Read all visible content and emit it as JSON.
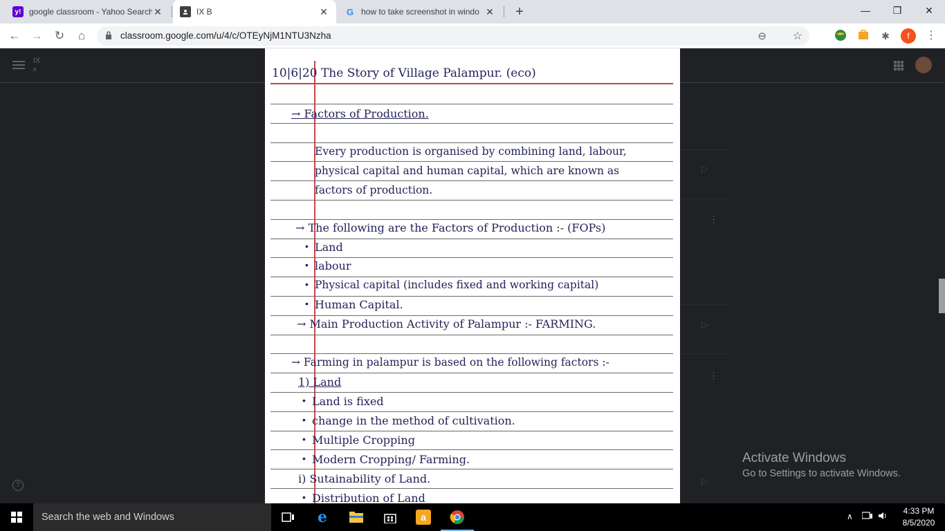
{
  "browser": {
    "tabs": [
      {
        "favicon": "y!",
        "title": "google classroom - Yahoo Search",
        "close": "✕"
      },
      {
        "favicon": "",
        "title": "IX B",
        "close": "✕"
      },
      {
        "favicon": "G",
        "title": "how to take screenshot in windo",
        "close": "✕"
      }
    ],
    "new_tab": "+",
    "window_controls": {
      "minimize": "—",
      "restore": "❐",
      "close": "✕"
    },
    "url": "classroom.google.com/u/4/c/OTEyNjM1NTU3Nzha",
    "nav": {
      "back": "←",
      "forward": "→",
      "reload": "↻",
      "home": "⌂"
    },
    "extensions": {
      "zoom": "⊖",
      "star": "☆",
      "puzzle": "✱",
      "profile": "f",
      "menu": "⋮"
    }
  },
  "classroom": {
    "class_name": "IX",
    "class_section": "B",
    "help": "?"
  },
  "notebook": {
    "lines": [
      {
        "text": "10|6|20  The Story of Village Palampur. (eco)",
        "underline": false
      },
      {
        "text": "→  Factors of Production.",
        "underline": true
      },
      {
        "text": "Every production is organised by combining land, labour,",
        "underline": false
      },
      {
        "text": "physical capital and human capital, which are known as",
        "underline": false
      },
      {
        "text": "factors of production.",
        "underline": false
      },
      {
        "text": "→ The following are the Factors of Production :- (FOPs)",
        "underline": false
      },
      {
        "text": "Land",
        "underline": false
      },
      {
        "text": "labour",
        "underline": false
      },
      {
        "text": "Physical capital (includes fixed and working capital)",
        "underline": false
      },
      {
        "text": "Human Capital.",
        "underline": false
      },
      {
        "text": "→ Main Production Activity of Palampur :- FARMING.",
        "underline": false
      },
      {
        "text": "→ Farming in palampur is based on the following factors :-",
        "underline": false
      },
      {
        "text": "1) Land",
        "underline": false
      },
      {
        "text": "Land is fixed",
        "underline": false
      },
      {
        "text": "change in the method of cultivation.",
        "underline": false
      },
      {
        "text": "Multiple Cropping",
        "underline": false
      },
      {
        "text": "Modern Cropping/ Farming.",
        "underline": false
      },
      {
        "text": "i) Sutainability of Land.",
        "underline": false
      },
      {
        "text": "Distribution of Land",
        "underline": false
      }
    ]
  },
  "watermark": {
    "title": "Activate Windows",
    "subtitle": "Go to Settings to activate Windows."
  },
  "taskbar": {
    "search_placeholder": "Search the web and Windows",
    "time": "4:33 PM",
    "date": "8/5/2020"
  }
}
